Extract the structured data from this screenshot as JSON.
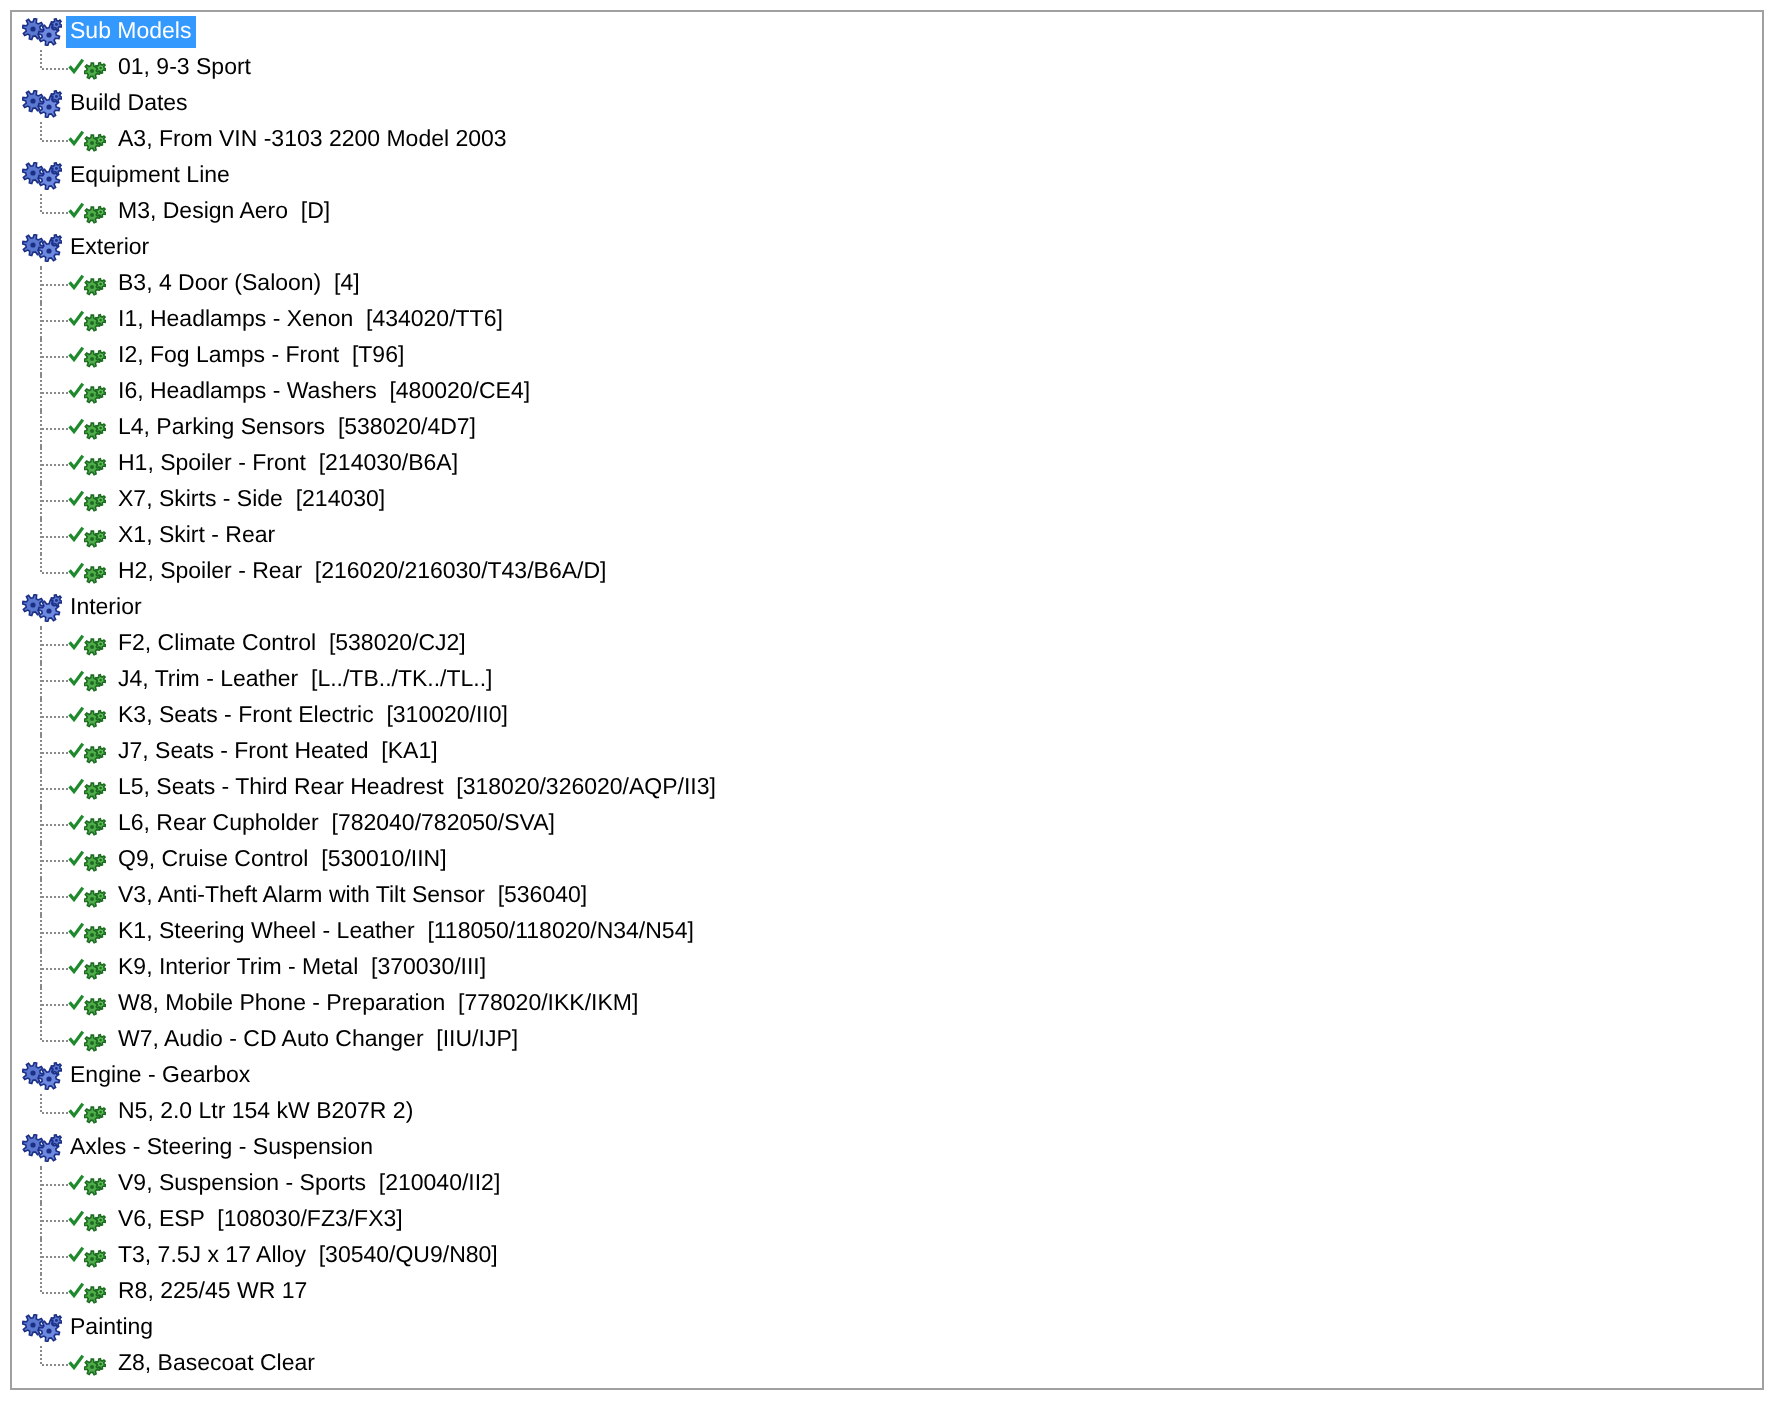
{
  "tree": {
    "items": [
      {
        "label": "Sub Models",
        "selected": true,
        "children": [
          {
            "label": "01, 9-3 Sport",
            "checked": true,
            "selected": false
          }
        ]
      },
      {
        "label": "Build Dates",
        "selected": false,
        "children": [
          {
            "label": "A3, From VIN -3103 2200 Model 2003",
            "checked": true,
            "selected": false
          }
        ]
      },
      {
        "label": "Equipment Line",
        "selected": false,
        "children": [
          {
            "label": "M3, Design Aero  [D]",
            "checked": true,
            "selected": false
          }
        ]
      },
      {
        "label": "Exterior",
        "selected": false,
        "children": [
          {
            "label": "B3, 4 Door (Saloon)  [4]",
            "checked": true,
            "selected": false
          },
          {
            "label": "I1, Headlamps - Xenon  [434020/TT6]",
            "checked": true,
            "selected": false
          },
          {
            "label": "I2, Fog Lamps - Front  [T96]",
            "checked": true,
            "selected": false
          },
          {
            "label": "I6, Headlamps - Washers  [480020/CE4]",
            "checked": true,
            "selected": false
          },
          {
            "label": "L4, Parking Sensors  [538020/4D7]",
            "checked": true,
            "selected": false
          },
          {
            "label": "H1, Spoiler - Front  [214030/B6A]",
            "checked": true,
            "selected": false
          },
          {
            "label": "X7, Skirts - Side  [214030]",
            "checked": true,
            "selected": false
          },
          {
            "label": "X1, Skirt - Rear",
            "checked": true,
            "selected": false
          },
          {
            "label": "H2, Spoiler - Rear  [216020/216030/T43/B6A/D]",
            "checked": true,
            "selected": false
          }
        ]
      },
      {
        "label": "Interior",
        "selected": false,
        "children": [
          {
            "label": "F2, Climate Control  [538020/CJ2]",
            "checked": true,
            "selected": false
          },
          {
            "label": "J4, Trim - Leather  [L../TB../TK../TL..]",
            "checked": true,
            "selected": false
          },
          {
            "label": "K3, Seats - Front Electric  [310020/II0]",
            "checked": true,
            "selected": false
          },
          {
            "label": "J7, Seats - Front Heated  [KA1]",
            "checked": true,
            "selected": false
          },
          {
            "label": "L5, Seats - Third Rear Headrest  [318020/326020/AQP/II3]",
            "checked": true,
            "selected": false
          },
          {
            "label": "L6, Rear Cupholder  [782040/782050/SVA]",
            "checked": true,
            "selected": false
          },
          {
            "label": "Q9, Cruise Control  [530010/IIN]",
            "checked": true,
            "selected": false
          },
          {
            "label": "V3, Anti-Theft Alarm with Tilt Sensor  [536040]",
            "checked": true,
            "selected": false
          },
          {
            "label": "K1, Steering Wheel - Leather  [118050/118020/N34/N54]",
            "checked": true,
            "selected": false
          },
          {
            "label": "K9, Interior Trim - Metal  [370030/III]",
            "checked": true,
            "selected": false
          },
          {
            "label": "W8, Mobile Phone - Preparation  [778020/IKK/IKM]",
            "checked": true,
            "selected": false
          },
          {
            "label": "W7, Audio - CD Auto Changer  [IIU/IJP]",
            "checked": true,
            "selected": false
          }
        ]
      },
      {
        "label": "Engine - Gearbox",
        "selected": false,
        "children": [
          {
            "label": "N5, 2.0 Ltr 154 kW B207R 2)",
            "checked": true,
            "selected": false
          }
        ]
      },
      {
        "label": "Axles - Steering - Suspension",
        "selected": false,
        "children": [
          {
            "label": "V9, Suspension - Sports  [210040/II2]",
            "checked": true,
            "selected": false
          },
          {
            "label": "V6, ESP  [108030/FZ3/FX3]",
            "checked": true,
            "selected": false
          },
          {
            "label": "T3, 7.5J x 17 Alloy  [30540/QU9/N80]",
            "checked": true,
            "selected": false
          },
          {
            "label": "R8, 225/45 WR 17",
            "checked": true,
            "selected": false
          }
        ]
      },
      {
        "label": "Painting",
        "selected": false,
        "children": [
          {
            "label": "Z8, Basecoat Clear",
            "checked": true,
            "selected": false
          }
        ]
      }
    ]
  }
}
